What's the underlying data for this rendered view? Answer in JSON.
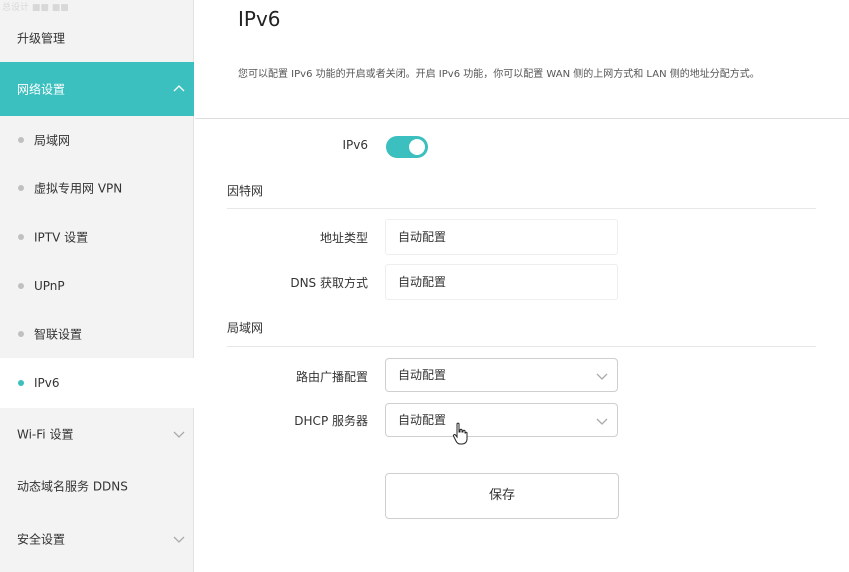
{
  "sidebar": {
    "faded_top": "总设计 ■■ ■■",
    "items": [
      {
        "label": "升级管理"
      },
      {
        "label": "网络设置"
      },
      {
        "label": "局域网"
      },
      {
        "label": "虚拟专用网 VPN"
      },
      {
        "label": "IPTV 设置"
      },
      {
        "label": "UPnP"
      },
      {
        "label": "智联设置"
      },
      {
        "label": "IPv6"
      },
      {
        "label": "Wi-Fi 设置"
      },
      {
        "label": "动态域名服务 DDNS"
      },
      {
        "label": "安全设置"
      }
    ]
  },
  "page": {
    "title": "IPv6",
    "description": "您可以配置 IPv6 功能的开启或者关闭。开启 IPv6 功能，你可以配置 WAN 侧的上网方式和 LAN 侧的地址分配方式。"
  },
  "ipv6_toggle": {
    "label": "IPv6",
    "state": "on"
  },
  "internet": {
    "title": "因特网",
    "address_type": {
      "label": "地址类型",
      "value": "自动配置"
    },
    "dns": {
      "label": "DNS 获取方式",
      "value": "自动配置"
    }
  },
  "lan": {
    "title": "局域网",
    "router_adv": {
      "label": "路由广播配置",
      "value": "自动配置"
    },
    "dhcp": {
      "label": "DHCP 服务器",
      "value": "自动配置"
    }
  },
  "save_label": "保存",
  "colors": {
    "accent": "#3bbfbf"
  }
}
